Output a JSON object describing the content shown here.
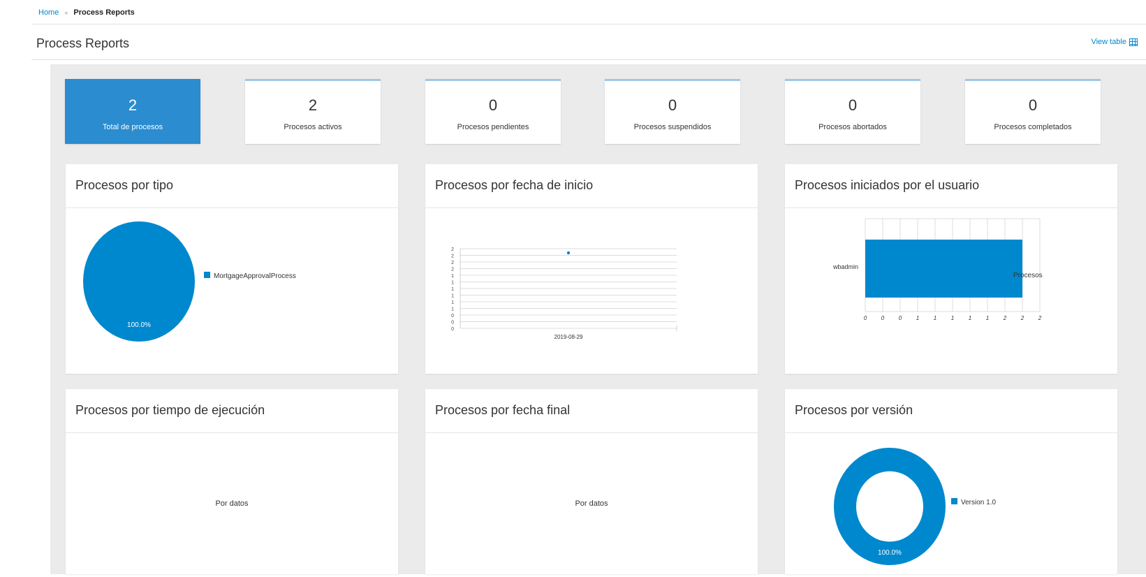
{
  "breadcrumb": {
    "home": "Home",
    "separator": "»",
    "current": "Process Reports"
  },
  "header": {
    "title": "Process Reports",
    "view_table_label": "View table"
  },
  "stats": [
    {
      "value": "2",
      "label": "Total de procesos",
      "active": true
    },
    {
      "value": "2",
      "label": "Procesos activos",
      "active": false
    },
    {
      "value": "0",
      "label": "Procesos pendientes",
      "active": false
    },
    {
      "value": "0",
      "label": "Procesos suspendidos",
      "active": false
    },
    {
      "value": "0",
      "label": "Procesos abortados",
      "active": false
    },
    {
      "value": "0",
      "label": "Procesos completados",
      "active": false
    }
  ],
  "cards": {
    "by_type": {
      "title": "Procesos por tipo"
    },
    "by_start_date": {
      "title": "Procesos por fecha de inicio"
    },
    "by_user": {
      "title": "Procesos iniciados por el usuario"
    },
    "by_duration": {
      "title": "Procesos por tiempo de ejecución",
      "no_data": "Por datos"
    },
    "by_end_date": {
      "title": "Procesos por fecha final",
      "no_data": "Por datos"
    },
    "by_version": {
      "title": "Procesos por versión"
    }
  },
  "colors": {
    "accent": "#0088ce",
    "stat_active_bg": "#2b8ccf",
    "canvas_bg": "#ebebeb"
  },
  "chart_data": [
    {
      "type": "pie",
      "title": "Procesos por tipo",
      "slices": [
        {
          "label": "MortgageApprovalProcess",
          "value": 100.0,
          "display": "100.0%"
        }
      ]
    },
    {
      "type": "scatter",
      "title": "Procesos por fecha de inicio",
      "x": [
        "2019-08-29"
      ],
      "series": [
        {
          "values": [
            2
          ]
        }
      ],
      "y_tick_labels": [
        "2",
        "2",
        "2",
        "2",
        "1",
        "1",
        "1",
        "1",
        "1",
        "1",
        "0",
        "0",
        "0"
      ],
      "ylim": [
        0,
        2
      ],
      "grid": true
    },
    {
      "type": "bar",
      "orientation": "horizontal",
      "title": "Procesos iniciados por el usuario",
      "categories": [
        "wbadmin"
      ],
      "series": [
        {
          "name": "Procesos",
          "values": [
            2
          ]
        }
      ],
      "x_tick_labels": [
        "0",
        "0",
        "0",
        "1",
        "1",
        "1",
        "1",
        "1",
        "2",
        "2",
        "2"
      ],
      "xlim": [
        0,
        2
      ],
      "grid": true
    },
    {
      "type": "pie",
      "variant": "donut",
      "title": "Procesos por versión",
      "slices": [
        {
          "label": "Version 1.0",
          "value": 100.0,
          "display": "100.0%"
        }
      ]
    }
  ]
}
